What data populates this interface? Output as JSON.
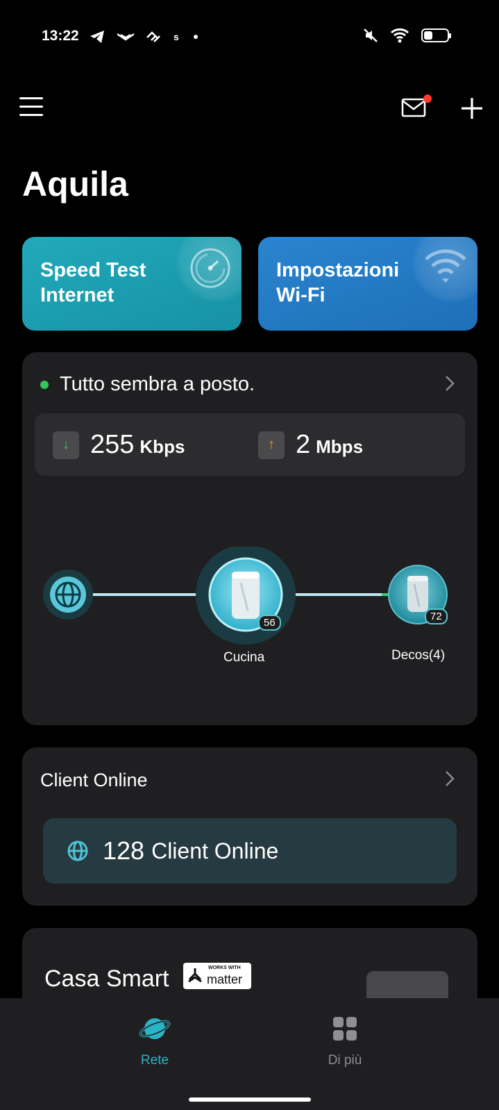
{
  "status_bar": {
    "time": "13:22",
    "left_icons": [
      "telegram-icon",
      "app-icon",
      "app-icon",
      "s-icon",
      "dot-icon"
    ],
    "right_icons": [
      "mute-icon",
      "wifi-icon",
      "battery-icon"
    ],
    "battery_level": 0.35
  },
  "header": {
    "menu_icon": "hamburger-menu-icon",
    "mail_icon": "mail-icon",
    "mail_unread_color": "#ff3b30",
    "add_icon": "plus-icon"
  },
  "page": {
    "title": "Aquila"
  },
  "tiles": [
    {
      "label": "Speed Test\nInternet",
      "icon": "speedometer-icon",
      "color": "#1da3b5"
    },
    {
      "label": "Impostazioni\nWi-Fi",
      "icon": "wifi-icon",
      "color": "#2479c3"
    }
  ],
  "network_status": {
    "text": "Tutto sembra a posto.",
    "dot_color": "#34c759",
    "download": {
      "value": "255",
      "unit": "Kbps",
      "arrow_color": "#34c759"
    },
    "upload": {
      "value": "2",
      "unit": "Mbps",
      "arrow_color": "#ff9500"
    },
    "topology": {
      "internet_icon": "globe-icon",
      "main_node": {
        "label": "Cucina",
        "badge": "56"
      },
      "satellite": {
        "label": "Decos(4)",
        "badge": "72"
      }
    }
  },
  "clients": {
    "title": "Client Online",
    "count": "128",
    "label": "Client Online"
  },
  "smart_home": {
    "title": "Casa Smart",
    "badge_top": "WORKS WITH",
    "badge_word": "matter"
  },
  "bottom_nav": [
    {
      "label": "Rete",
      "icon": "planet-icon",
      "active": true,
      "color": "#2bb3c6"
    },
    {
      "label": "Di più",
      "icon": "grid-icon",
      "active": false,
      "color": "#8e8e93"
    }
  ]
}
